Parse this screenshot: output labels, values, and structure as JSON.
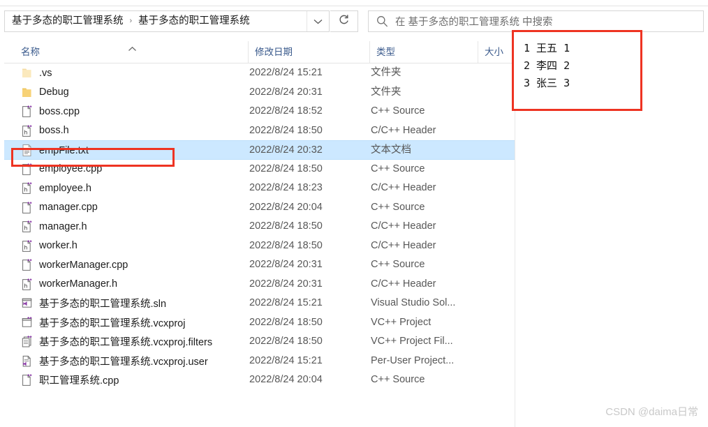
{
  "window": {
    "address": {
      "crumb_1": "基于多态的职工管理系统",
      "separator": "›",
      "crumb_2": "基于多态的职工管理系统",
      "dropdown_icon": "chevron-down-icon",
      "refresh_icon": "refresh-icon"
    },
    "search": {
      "placeholder": "在 基于多态的职工管理系统 中搜索",
      "icon": "search-icon"
    }
  },
  "file_list": {
    "columns": {
      "name": "名称",
      "date": "修改日期",
      "type": "类型",
      "size": "大小",
      "sort_indicator": "sort-ascending-caret"
    },
    "rows": [
      {
        "name": ".vs",
        "date": "2022/8/24 15:21",
        "type": "文件夹",
        "size": "",
        "icon": "folder-icon-hidden",
        "selected": false
      },
      {
        "name": "Debug",
        "date": "2022/8/24 20:31",
        "type": "文件夹",
        "size": "",
        "icon": "folder-icon",
        "selected": false
      },
      {
        "name": "boss.cpp",
        "date": "2022/8/24 18:52",
        "type": "C++ Source",
        "size": "",
        "icon": "cpp-source-icon",
        "selected": false
      },
      {
        "name": "boss.h",
        "date": "2022/8/24 18:50",
        "type": "C/C++ Header",
        "size": "",
        "icon": "cpp-header-icon",
        "selected": false
      },
      {
        "name": "empFile.txt",
        "date": "2022/8/24 20:32",
        "type": "文本文档",
        "size": "",
        "icon": "text-file-icon",
        "selected": true
      },
      {
        "name": "employee.cpp",
        "date": "2022/8/24 18:50",
        "type": "C++ Source",
        "size": "",
        "icon": "cpp-source-icon",
        "selected": false
      },
      {
        "name": "employee.h",
        "date": "2022/8/24 18:23",
        "type": "C/C++ Header",
        "size": "",
        "icon": "cpp-header-icon",
        "selected": false
      },
      {
        "name": "manager.cpp",
        "date": "2022/8/24 20:04",
        "type": "C++ Source",
        "size": "",
        "icon": "cpp-source-icon",
        "selected": false
      },
      {
        "name": "manager.h",
        "date": "2022/8/24 18:50",
        "type": "C/C++ Header",
        "size": "",
        "icon": "cpp-header-icon",
        "selected": false
      },
      {
        "name": "worker.h",
        "date": "2022/8/24 18:50",
        "type": "C/C++ Header",
        "size": "",
        "icon": "cpp-header-icon",
        "selected": false
      },
      {
        "name": "workerManager.cpp",
        "date": "2022/8/24 20:31",
        "type": "C++ Source",
        "size": "",
        "icon": "cpp-source-icon",
        "selected": false
      },
      {
        "name": "workerManager.h",
        "date": "2022/8/24 20:31",
        "type": "C/C++ Header",
        "size": "",
        "icon": "cpp-header-icon",
        "selected": false
      },
      {
        "name": "基于多态的职工管理系统.sln",
        "date": "2022/8/24 15:21",
        "type": "Visual Studio Sol...",
        "size": "",
        "icon": "visual-studio-solution-icon",
        "selected": false
      },
      {
        "name": "基于多态的职工管理系统.vcxproj",
        "date": "2022/8/24 18:50",
        "type": "VC++ Project",
        "size": "",
        "icon": "vcxproj-icon",
        "selected": false
      },
      {
        "name": "基于多态的职工管理系统.vcxproj.filters",
        "date": "2022/8/24 18:50",
        "type": "VC++ Project Fil...",
        "size": "",
        "icon": "vcxproj-filters-icon",
        "selected": false
      },
      {
        "name": "基于多态的职工管理系统.vcxproj.user",
        "date": "2022/8/24 15:21",
        "type": "Per-User Project...",
        "size": "",
        "icon": "vcxproj-user-icon",
        "selected": false
      },
      {
        "name": "职工管理系统.cpp",
        "date": "2022/8/24 20:04",
        "type": "C++ Source",
        "size": "",
        "icon": "cpp-source-icon",
        "selected": false
      }
    ]
  },
  "annotations": {
    "file_highlight_color": "#ee3322",
    "selection_color": "#cce8ff",
    "content_box": {
      "lines": [
        "1 王五 1",
        "2 李四 2",
        "3 张三 3"
      ]
    }
  },
  "watermark": "CSDN @daima日常"
}
